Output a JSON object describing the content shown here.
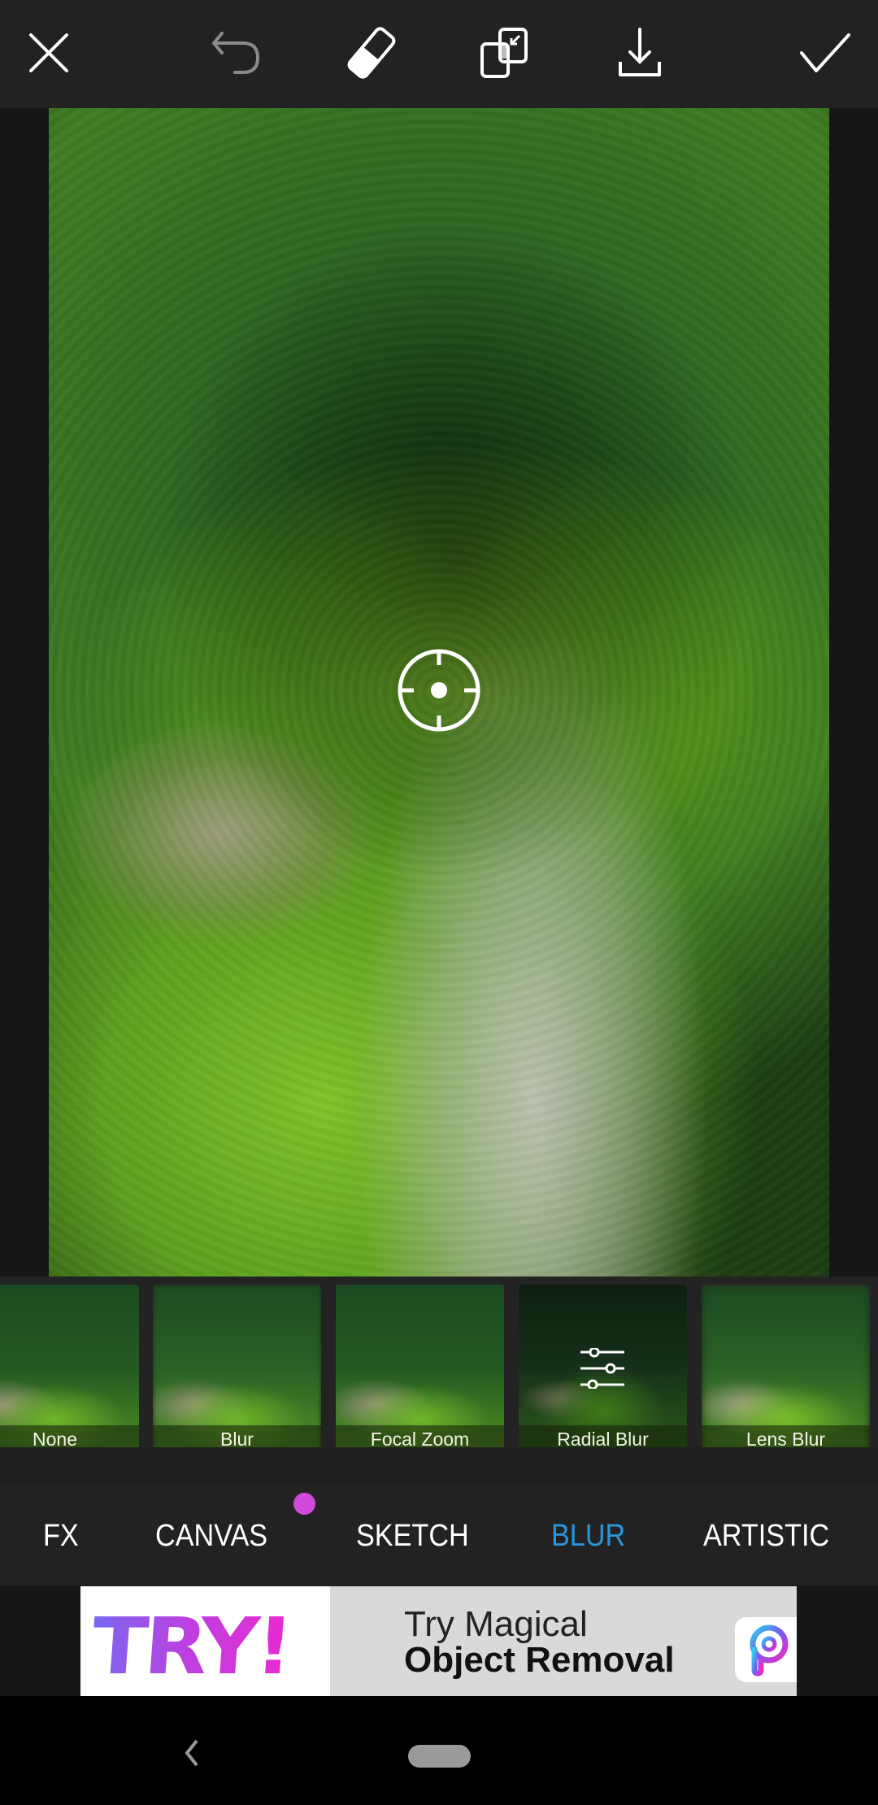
{
  "toolbar": {
    "icons": [
      "close-icon",
      "undo-icon",
      "eraser-icon",
      "blend-layers-icon",
      "download-icon",
      "apply-check-icon"
    ],
    "undo_enabled": false
  },
  "canvas": {
    "focus_control": "crosshair-target-icon"
  },
  "effects": {
    "selected": "Radial Blur",
    "items": [
      {
        "label": "None"
      },
      {
        "label": "Blur"
      },
      {
        "label": "Focal Zoom"
      },
      {
        "label": "Radial Blur",
        "selected": true,
        "overlay_icon": "sliders-settings-icon"
      },
      {
        "label": "Lens Blur"
      }
    ]
  },
  "categories": {
    "active": "BLUR",
    "items": [
      {
        "label": "FX"
      },
      {
        "label": "CANVAS",
        "badge": "new-dot"
      },
      {
        "label": "SKETCH"
      },
      {
        "label": "BLUR",
        "active": true
      },
      {
        "label": "ARTISTIC"
      }
    ],
    "active_color": "#2a95dc",
    "badge_color": "#d24adb"
  },
  "ad": {
    "badge_text": "TRY!",
    "line1": "Try Magical",
    "line2": "Object Removal",
    "logo": "picsart-logo-icon"
  },
  "system_nav": {
    "back": "back-chevron-icon",
    "home": "home-pill"
  }
}
